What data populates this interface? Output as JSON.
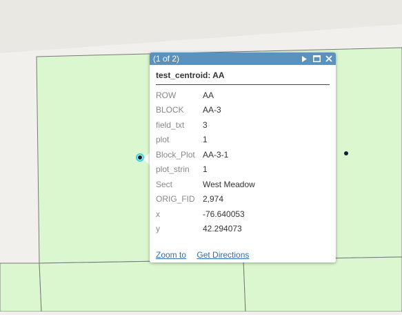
{
  "map": {
    "colors": {
      "background": "#f1f0ec",
      "road": "#e7e6e1",
      "parcel_fill": "#dbf7cf",
      "parcel_stroke": "#777777",
      "point": "#121c3a",
      "selection": "#35d3e6"
    }
  },
  "popup": {
    "header_title": "(1 of 2)",
    "header_color": "#5a91bd",
    "icons": [
      "next-icon",
      "maximize-icon",
      "close-icon"
    ],
    "title": "test_centroid: AA",
    "attributes": [
      {
        "key": "ROW",
        "value": "AA"
      },
      {
        "key": "BLOCK",
        "value": "AA-3"
      },
      {
        "key": "field_txt",
        "value": "3"
      },
      {
        "key": "plot",
        "value": "1"
      },
      {
        "key": "Block_Plot",
        "value": "AA-3-1"
      },
      {
        "key": "plot_strin",
        "value": "1"
      },
      {
        "key": "Sect",
        "value": "West Meadow"
      },
      {
        "key": "ORIG_FID",
        "value": "2,974"
      },
      {
        "key": "x",
        "value": "-76.640053"
      },
      {
        "key": "y",
        "value": "42.294073"
      }
    ],
    "actions": {
      "zoom_to": "Zoom to",
      "get_directions": "Get Directions"
    }
  }
}
